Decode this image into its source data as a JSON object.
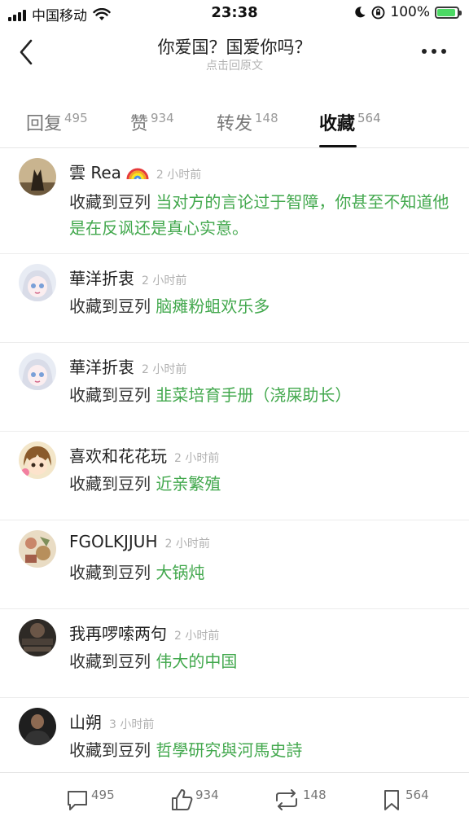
{
  "status_bar": {
    "carrier": "中国移动",
    "time": "23:38",
    "battery_percent": "100%",
    "battery_level": 1.0,
    "icons": [
      "signal-icon",
      "wifi-icon",
      "moon-icon",
      "orientation-lock-icon",
      "battery-icon"
    ]
  },
  "nav": {
    "title": "你爱国？国爱你吗？",
    "subtitle": "点击回原文",
    "icons": [
      "back-icon",
      "more-icon"
    ]
  },
  "tabs": [
    {
      "label": "回复",
      "count": "495"
    },
    {
      "label": "赞",
      "count": "934"
    },
    {
      "label": "转发",
      "count": "148"
    },
    {
      "label": "收藏",
      "count": "564",
      "active": true
    }
  ],
  "items": [
    {
      "name": "雲 Rea",
      "badge": "rainbow-emoji",
      "time": "2 小时前",
      "prefix": "收藏到豆列 ",
      "list": "当对方的言论过于智障，你甚至不知道他是在反讽还是真心实意。"
    },
    {
      "name": "華洋折衷",
      "time": "2 小时前",
      "prefix": "收藏到豆列 ",
      "list": "脑瘫粉蛆欢乐多"
    },
    {
      "name": "華洋折衷",
      "time": "2 小时前",
      "prefix": "收藏到豆列 ",
      "list": "韭菜培育手册（浇屎助长）"
    },
    {
      "name": "喜欢和花花玩",
      "time": "2 小时前",
      "prefix": "收藏到豆列 ",
      "list": "近亲繁殖"
    },
    {
      "name": "FGOLKJJUH",
      "time": "2 小时前",
      "prefix": "收藏到豆列 ",
      "list": "大锅炖"
    },
    {
      "name": "我再啰嗦两句",
      "time": "2 小时前",
      "prefix": "收藏到豆列 ",
      "list": "伟大的中国"
    },
    {
      "name": "山朔",
      "time": "3 小时前",
      "prefix": "收藏到豆列 ",
      "list": "哲學研究與河馬史詩"
    }
  ],
  "bottom_bar": [
    {
      "icon": "comment-icon",
      "count": "495"
    },
    {
      "icon": "like-icon",
      "count": "934"
    },
    {
      "icon": "repost-icon",
      "count": "148"
    },
    {
      "icon": "bookmark-icon",
      "count": "564"
    }
  ],
  "colors": {
    "list_green": "#42a84d",
    "time_gray": "#b0b0b0",
    "battery_green": "#4cd964"
  }
}
